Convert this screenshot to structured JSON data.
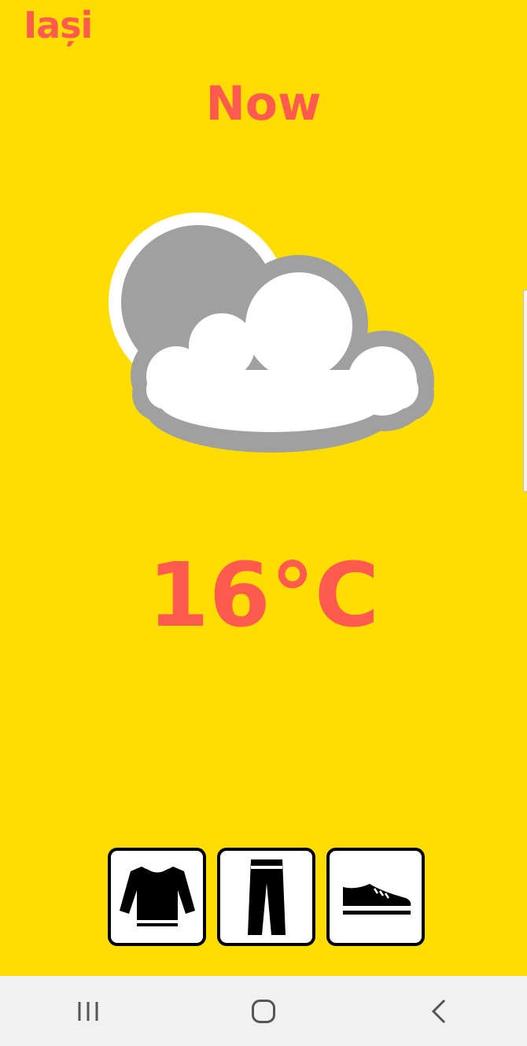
{
  "location": {
    "city": "Iași"
  },
  "forecast": {
    "period": "Now",
    "temperature": "16°C",
    "condition_icon": "partly-cloudy-icon"
  },
  "clothing": [
    {
      "item": "sweater",
      "icon": "sweater-icon"
    },
    {
      "item": "trousers",
      "icon": "trousers-icon"
    },
    {
      "item": "sneaker",
      "icon": "sneaker-icon"
    }
  ],
  "navigation": {
    "buttons": [
      {
        "name": "recent-apps",
        "icon": "recent-apps-icon"
      },
      {
        "name": "home",
        "icon": "home-icon"
      },
      {
        "name": "back",
        "icon": "back-icon"
      }
    ]
  },
  "colors": {
    "background": "#FFDD00",
    "accent_text": "#FF5A4E",
    "cloud_outline": "#A0A0A0",
    "navbar": "#F1F1F1"
  }
}
